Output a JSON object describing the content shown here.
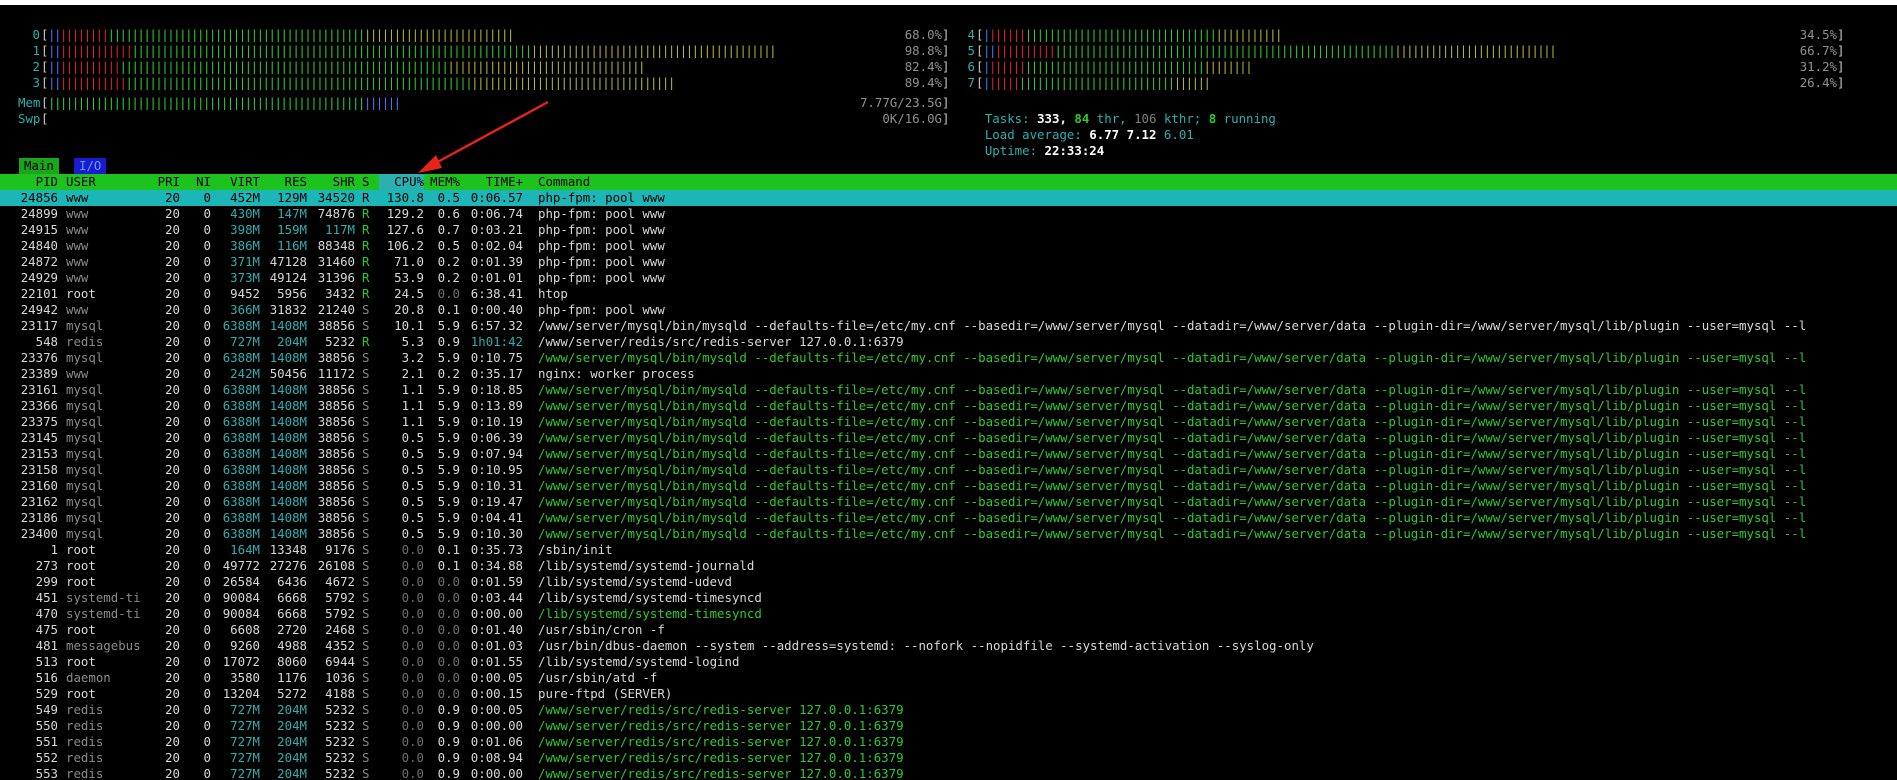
{
  "meters": {
    "cpus": [
      {
        "label": "0",
        "percent": "68.0%",
        "bar": "||||||||||||||||||||||||||||||||||||||||||||||||||||||||||||||||||||||||||||||",
        "fill": 0.68
      },
      {
        "label": "1",
        "percent": "98.8%",
        "bar": "||||||||||||||||||||||||||||||||||||||||||||||||||||||||||||||||||||||||||||||||||||||||||||||||||||||||||||||||||||||||||",
        "fill": 0.988
      },
      {
        "label": "2",
        "percent": "82.4%",
        "bar": "||||||||||||||||||||||||||||||||||||||||||||||||||||||||||||||||||||||||||||||||||||||||||||||||||||",
        "fill": 0.824
      },
      {
        "label": "3",
        "percent": "89.4%",
        "bar": "|||||||||||||||||||||||||||||||||||||||||||||||||||||||||||||||||||||||||||||||||||||||||||||||||||||||||",
        "fill": 0.894
      },
      {
        "label": "4",
        "percent": "34.5%",
        "bar": "|||||||||||||||||||||||||||||||||||||||||||||||||||||||||||",
        "fill": 0.345
      },
      {
        "label": "5",
        "percent": "66.7%",
        "bar": "|||||||||||||||||||||||||||||||||||||||||||||||||||||||||||||||||||||||||||||||||||||||||||||||||||||||",
        "fill": 0.667
      },
      {
        "label": "6",
        "percent": "31.2%",
        "bar": "|||||||||||||||||||||||||||||||||||||||||||||||||||||||",
        "fill": 0.312
      },
      {
        "label": "7",
        "percent": "26.4%",
        "bar": "||||||||||||||||||||||||||||||||||||||||||||||||",
        "fill": 0.264
      }
    ],
    "mem": {
      "label": "Mem",
      "value": "7.77G/23.5G",
      "bar": "||||||||||||||||||||||||||||||||||||||||||||||||||||||||||||||||||||||||||",
      "fill": 0.33
    },
    "swp": {
      "label": "Swp",
      "value": "0K/16.0G"
    }
  },
  "summary": {
    "tasks_label": "Tasks:",
    "tasks": "333,",
    "thr": "84",
    "thr_label": "thr,",
    "kthr": "106",
    "kthr_label": "kthr;",
    "running": "8",
    "running_label": "running",
    "load_label": "Load average:",
    "load1": "6.77",
    "load5": "7.12",
    "load15": "6.01",
    "uptime_label": "Uptime:",
    "uptime": "22:33:24"
  },
  "tabs": {
    "main": "Main",
    "io": "I/O"
  },
  "columns": {
    "pid": "PID",
    "user": "USER",
    "pri": "PRI",
    "ni": "NI",
    "virt": "VIRT",
    "res": "RES",
    "shr": "SHR",
    "s": "S",
    "cpu": "CPU%",
    "mem": "MEM%",
    "time": "TIME+",
    "command": "Command"
  },
  "processes": [
    {
      "pid": "24856",
      "user": "www",
      "pri": "20",
      "ni": "0",
      "virt": "452M",
      "res": "129M",
      "shr": "34520",
      "s": "R",
      "cpu": "130.8",
      "mem": "0.5",
      "time": "0:06.57",
      "command": "php-fpm: pool www"
    },
    {
      "pid": "24899",
      "user": "www",
      "pri": "20",
      "ni": "0",
      "virt": "430M",
      "res": "147M",
      "shr": "74876",
      "s": "R",
      "cpu": "129.2",
      "mem": "0.6",
      "time": "0:06.74",
      "command": "php-fpm: pool www"
    },
    {
      "pid": "24915",
      "user": "www",
      "pri": "20",
      "ni": "0",
      "virt": "398M",
      "res": "159M",
      "shr": "117M",
      "s": "R",
      "cpu": "127.6",
      "mem": "0.7",
      "time": "0:03.21",
      "command": "php-fpm: pool www"
    },
    {
      "pid": "24840",
      "user": "www",
      "pri": "20",
      "ni": "0",
      "virt": "386M",
      "res": "116M",
      "shr": "88348",
      "s": "R",
      "cpu": "106.2",
      "mem": "0.5",
      "time": "0:02.04",
      "command": "php-fpm: pool www"
    },
    {
      "pid": "24872",
      "user": "www",
      "pri": "20",
      "ni": "0",
      "virt": "371M",
      "res": "47128",
      "shr": "31460",
      "s": "R",
      "cpu": "71.0",
      "mem": "0.2",
      "time": "0:01.39",
      "command": "php-fpm: pool www"
    },
    {
      "pid": "24929",
      "user": "www",
      "pri": "20",
      "ni": "0",
      "virt": "373M",
      "res": "49124",
      "shr": "31396",
      "s": "R",
      "cpu": "53.9",
      "mem": "0.2",
      "time": "0:01.01",
      "command": "php-fpm: pool www"
    },
    {
      "pid": "22101",
      "user": "root",
      "pri": "20",
      "ni": "0",
      "virt": "9452",
      "res": "5956",
      "shr": "3432",
      "s": "R",
      "cpu": "24.5",
      "mem": "0.0",
      "time": "6:38.41",
      "command": "htop"
    },
    {
      "pid": "24942",
      "user": "www",
      "pri": "20",
      "ni": "0",
      "virt": "366M",
      "res": "31832",
      "shr": "21240",
      "s": "S",
      "cpu": "20.8",
      "mem": "0.1",
      "time": "0:00.40",
      "command": "php-fpm: pool www"
    },
    {
      "pid": "23117",
      "user": "mysql",
      "pri": "20",
      "ni": "0",
      "virt": "6388M",
      "res": "1408M",
      "shr": "38856",
      "s": "S",
      "cpu": "10.1",
      "mem": "5.9",
      "time": "6:57.32",
      "command": "/www/server/mysql/bin/mysqld --defaults-file=/etc/my.cnf --basedir=/www/server/mysql --datadir=/www/server/data --plugin-dir=/www/server/mysql/lib/plugin --user=mysql --l"
    },
    {
      "pid": "548",
      "user": "redis",
      "pri": "20",
      "ni": "0",
      "virt": "727M",
      "res": "204M",
      "shr": "5232",
      "s": "R",
      "cpu": "5.3",
      "mem": "0.9",
      "time": "1h01:42",
      "command": "/www/server/redis/src/redis-server 127.0.0.1:6379"
    },
    {
      "pid": "23376",
      "user": "mysql",
      "pri": "20",
      "ni": "0",
      "virt": "6388M",
      "res": "1408M",
      "shr": "38856",
      "s": "S",
      "cpu": "3.2",
      "mem": "5.9",
      "time": "0:10.75",
      "command": "/www/server/mysql/bin/mysqld --defaults-file=/etc/my.cnf --basedir=/www/server/mysql --datadir=/www/server/data --plugin-dir=/www/server/mysql/lib/plugin --user=mysql --l"
    },
    {
      "pid": "23389",
      "user": "www",
      "pri": "20",
      "ni": "0",
      "virt": "242M",
      "res": "50456",
      "shr": "11172",
      "s": "S",
      "cpu": "2.1",
      "mem": "0.2",
      "time": "0:35.17",
      "command": "nginx: worker process"
    },
    {
      "pid": "23161",
      "user": "mysql",
      "pri": "20",
      "ni": "0",
      "virt": "6388M",
      "res": "1408M",
      "shr": "38856",
      "s": "S",
      "cpu": "1.1",
      "mem": "5.9",
      "time": "0:18.85",
      "command": "/www/server/mysql/bin/mysqld --defaults-file=/etc/my.cnf --basedir=/www/server/mysql --datadir=/www/server/data --plugin-dir=/www/server/mysql/lib/plugin --user=mysql --l"
    },
    {
      "pid": "23366",
      "user": "mysql",
      "pri": "20",
      "ni": "0",
      "virt": "6388M",
      "res": "1408M",
      "shr": "38856",
      "s": "S",
      "cpu": "1.1",
      "mem": "5.9",
      "time": "0:13.89",
      "command": "/www/server/mysql/bin/mysqld --defaults-file=/etc/my.cnf --basedir=/www/server/mysql --datadir=/www/server/data --plugin-dir=/www/server/mysql/lib/plugin --user=mysql --l"
    },
    {
      "pid": "23375",
      "user": "mysql",
      "pri": "20",
      "ni": "0",
      "virt": "6388M",
      "res": "1408M",
      "shr": "38856",
      "s": "S",
      "cpu": "1.1",
      "mem": "5.9",
      "time": "0:10.19",
      "command": "/www/server/mysql/bin/mysqld --defaults-file=/etc/my.cnf --basedir=/www/server/mysql --datadir=/www/server/data --plugin-dir=/www/server/mysql/lib/plugin --user=mysql --l"
    },
    {
      "pid": "23145",
      "user": "mysql",
      "pri": "20",
      "ni": "0",
      "virt": "6388M",
      "res": "1408M",
      "shr": "38856",
      "s": "S",
      "cpu": "0.5",
      "mem": "5.9",
      "time": "0:06.39",
      "command": "/www/server/mysql/bin/mysqld --defaults-file=/etc/my.cnf --basedir=/www/server/mysql --datadir=/www/server/data --plugin-dir=/www/server/mysql/lib/plugin --user=mysql --l"
    },
    {
      "pid": "23153",
      "user": "mysql",
      "pri": "20",
      "ni": "0",
      "virt": "6388M",
      "res": "1408M",
      "shr": "38856",
      "s": "S",
      "cpu": "0.5",
      "mem": "5.9",
      "time": "0:07.94",
      "command": "/www/server/mysql/bin/mysqld --defaults-file=/etc/my.cnf --basedir=/www/server/mysql --datadir=/www/server/data --plugin-dir=/www/server/mysql/lib/plugin --user=mysql --l"
    },
    {
      "pid": "23158",
      "user": "mysql",
      "pri": "20",
      "ni": "0",
      "virt": "6388M",
      "res": "1408M",
      "shr": "38856",
      "s": "S",
      "cpu": "0.5",
      "mem": "5.9",
      "time": "0:10.95",
      "command": "/www/server/mysql/bin/mysqld --defaults-file=/etc/my.cnf --basedir=/www/server/mysql --datadir=/www/server/data --plugin-dir=/www/server/mysql/lib/plugin --user=mysql --l"
    },
    {
      "pid": "23160",
      "user": "mysql",
      "pri": "20",
      "ni": "0",
      "virt": "6388M",
      "res": "1408M",
      "shr": "38856",
      "s": "S",
      "cpu": "0.5",
      "mem": "5.9",
      "time": "0:10.31",
      "command": "/www/server/mysql/bin/mysqld --defaults-file=/etc/my.cnf --basedir=/www/server/mysql --datadir=/www/server/data --plugin-dir=/www/server/mysql/lib/plugin --user=mysql --l"
    },
    {
      "pid": "23162",
      "user": "mysql",
      "pri": "20",
      "ni": "0",
      "virt": "6388M",
      "res": "1408M",
      "shr": "38856",
      "s": "S",
      "cpu": "0.5",
      "mem": "5.9",
      "time": "0:19.47",
      "command": "/www/server/mysql/bin/mysqld --defaults-file=/etc/my.cnf --basedir=/www/server/mysql --datadir=/www/server/data --plugin-dir=/www/server/mysql/lib/plugin --user=mysql --l"
    },
    {
      "pid": "23186",
      "user": "mysql",
      "pri": "20",
      "ni": "0",
      "virt": "6388M",
      "res": "1408M",
      "shr": "38856",
      "s": "S",
      "cpu": "0.5",
      "mem": "5.9",
      "time": "0:04.41",
      "command": "/www/server/mysql/bin/mysqld --defaults-file=/etc/my.cnf --basedir=/www/server/mysql --datadir=/www/server/data --plugin-dir=/www/server/mysql/lib/plugin --user=mysql --l"
    },
    {
      "pid": "23400",
      "user": "mysql",
      "pri": "20",
      "ni": "0",
      "virt": "6388M",
      "res": "1408M",
      "shr": "38856",
      "s": "S",
      "cpu": "0.5",
      "mem": "5.9",
      "time": "0:10.30",
      "command": "/www/server/mysql/bin/mysqld --defaults-file=/etc/my.cnf --basedir=/www/server/mysql --datadir=/www/server/data --plugin-dir=/www/server/mysql/lib/plugin --user=mysql --l"
    },
    {
      "pid": "1",
      "user": "root",
      "pri": "20",
      "ni": "0",
      "virt": "164M",
      "res": "13348",
      "shr": "9176",
      "s": "S",
      "cpu": "0.0",
      "mem": "0.1",
      "time": "0:35.73",
      "command": "/sbin/init"
    },
    {
      "pid": "273",
      "user": "root",
      "pri": "20",
      "ni": "0",
      "virt": "49772",
      "res": "27276",
      "shr": "26108",
      "s": "S",
      "cpu": "0.0",
      "mem": "0.1",
      "time": "0:34.88",
      "command": "/lib/systemd/systemd-journald"
    },
    {
      "pid": "299",
      "user": "root",
      "pri": "20",
      "ni": "0",
      "virt": "26584",
      "res": "6436",
      "shr": "4672",
      "s": "S",
      "cpu": "0.0",
      "mem": "0.0",
      "time": "0:01.59",
      "command": "/lib/systemd/systemd-udevd"
    },
    {
      "pid": "451",
      "user": "systemd-ti",
      "pri": "20",
      "ni": "0",
      "virt": "90084",
      "res": "6668",
      "shr": "5792",
      "s": "S",
      "cpu": "0.0",
      "mem": "0.0",
      "time": "0:03.44",
      "command": "/lib/systemd/systemd-timesyncd"
    },
    {
      "pid": "470",
      "user": "systemd-ti",
      "pri": "20",
      "ni": "0",
      "virt": "90084",
      "res": "6668",
      "shr": "5792",
      "s": "S",
      "cpu": "0.0",
      "mem": "0.0",
      "time": "0:00.00",
      "command": "/lib/systemd/systemd-timesyncd"
    },
    {
      "pid": "475",
      "user": "root",
      "pri": "20",
      "ni": "0",
      "virt": "6608",
      "res": "2720",
      "shr": "2468",
      "s": "S",
      "cpu": "0.0",
      "mem": "0.0",
      "time": "0:01.40",
      "command": "/usr/sbin/cron -f"
    },
    {
      "pid": "481",
      "user": "messagebus",
      "pri": "20",
      "ni": "0",
      "virt": "9260",
      "res": "4988",
      "shr": "4352",
      "s": "S",
      "cpu": "0.0",
      "mem": "0.0",
      "time": "0:01.03",
      "command": "/usr/bin/dbus-daemon --system --address=systemd: --nofork --nopidfile --systemd-activation --syslog-only"
    },
    {
      "pid": "513",
      "user": "root",
      "pri": "20",
      "ni": "0",
      "virt": "17072",
      "res": "8060",
      "shr": "6944",
      "s": "S",
      "cpu": "0.0",
      "mem": "0.0",
      "time": "0:01.55",
      "command": "/lib/systemd/systemd-logind"
    },
    {
      "pid": "516",
      "user": "daemon",
      "pri": "20",
      "ni": "0",
      "virt": "3580",
      "res": "1176",
      "shr": "1036",
      "s": "S",
      "cpu": "0.0",
      "mem": "0.0",
      "time": "0:00.05",
      "command": "/usr/sbin/atd -f"
    },
    {
      "pid": "529",
      "user": "root",
      "pri": "20",
      "ni": "0",
      "virt": "13204",
      "res": "5272",
      "shr": "4188",
      "s": "S",
      "cpu": "0.0",
      "mem": "0.0",
      "time": "0:00.15",
      "command": "pure-ftpd (SERVER)"
    },
    {
      "pid": "549",
      "user": "redis",
      "pri": "20",
      "ni": "0",
      "virt": "727M",
      "res": "204M",
      "shr": "5232",
      "s": "S",
      "cpu": "0.0",
      "mem": "0.9",
      "time": "0:00.05",
      "command": "/www/server/redis/src/redis-server 127.0.0.1:6379"
    },
    {
      "pid": "550",
      "user": "redis",
      "pri": "20",
      "ni": "0",
      "virt": "727M",
      "res": "204M",
      "shr": "5232",
      "s": "S",
      "cpu": "0.0",
      "mem": "0.9",
      "time": "0:00.00",
      "command": "/www/server/redis/src/redis-server 127.0.0.1:6379"
    },
    {
      "pid": "551",
      "user": "redis",
      "pri": "20",
      "ni": "0",
      "virt": "727M",
      "res": "204M",
      "shr": "5232",
      "s": "S",
      "cpu": "0.0",
      "mem": "0.9",
      "time": "0:01.06",
      "command": "/www/server/redis/src/redis-server 127.0.0.1:6379"
    },
    {
      "pid": "552",
      "user": "redis",
      "pri": "20",
      "ni": "0",
      "virt": "727M",
      "res": "204M",
      "shr": "5232",
      "s": "S",
      "cpu": "0.0",
      "mem": "0.9",
      "time": "0:08.94",
      "command": "/www/server/redis/src/redis-server 127.0.0.1:6379"
    },
    {
      "pid": "553",
      "user": "redis",
      "pri": "20",
      "ni": "0",
      "virt": "727M",
      "res": "204M",
      "shr": "5232",
      "s": "S",
      "cpu": "0.0",
      "mem": "0.9",
      "time": "0:00.00",
      "command": "/www/server/redis/src/redis-server 127.0.0.1:6379"
    }
  ],
  "colors": {
    "header_bg": "#1ec21e",
    "selected_bg": "#1cb6b6",
    "accent_cyan": "#2bb0b0",
    "running_green": "#2ccb2c",
    "arrow_red": "#e8231a"
  }
}
